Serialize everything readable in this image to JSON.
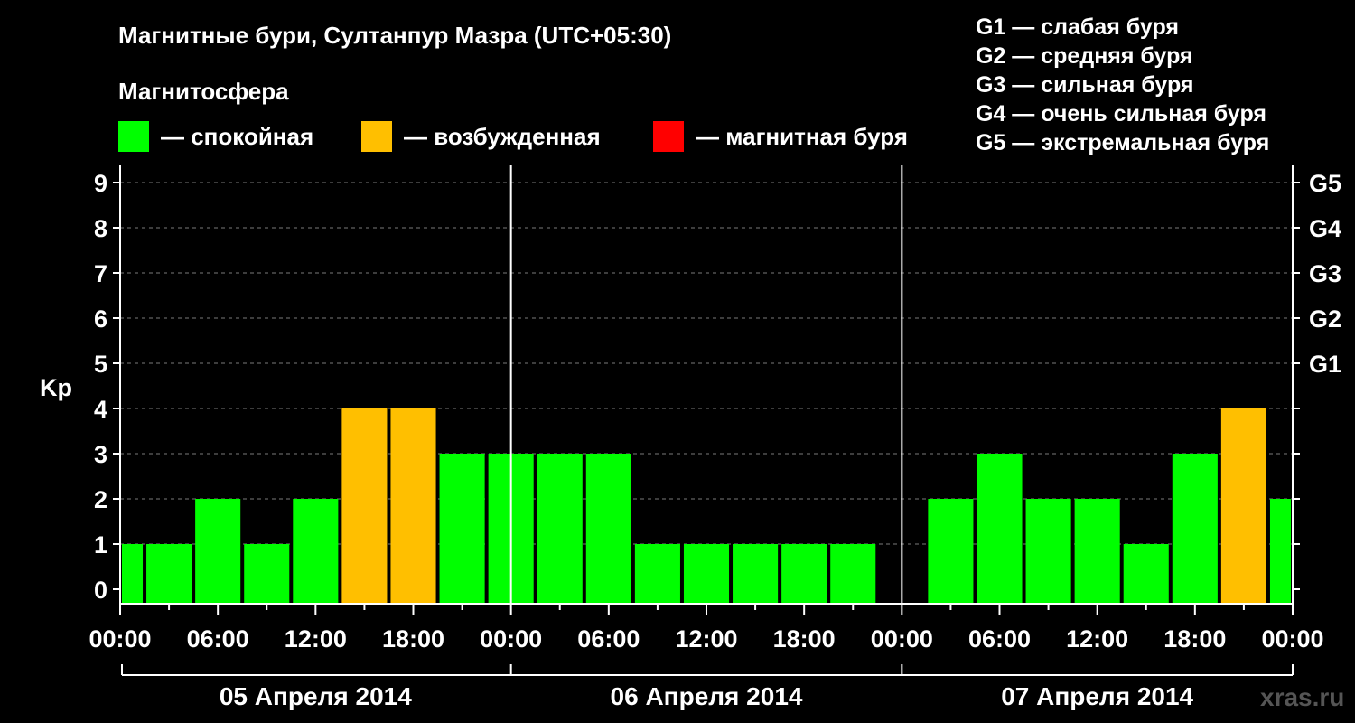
{
  "chart_data": {
    "type": "bar",
    "title": "Магнитные бури, Султанпур Мазра (UTC+05:30)",
    "subtitle": "Магнитосфера",
    "ylabel": "Kp",
    "ylim": [
      0,
      9
    ],
    "yticks": [
      "0",
      "1",
      "2",
      "3",
      "4",
      "5",
      "6",
      "7",
      "8",
      "9"
    ],
    "g_ticks": [
      {
        "kp": 5,
        "label": "G1"
      },
      {
        "kp": 6,
        "label": "G2"
      },
      {
        "kp": 7,
        "label": "G3"
      },
      {
        "kp": 8,
        "label": "G4"
      },
      {
        "kp": 9,
        "label": "G5"
      }
    ],
    "xticks": [
      "00:00",
      "06:00",
      "12:00",
      "18:00",
      "00:00",
      "06:00",
      "12:00",
      "18:00",
      "00:00",
      "06:00",
      "12:00",
      "18:00",
      "00:00"
    ],
    "days": [
      "05 Апреля 2014",
      "06 Апреля 2014",
      "07 Апреля 2014"
    ],
    "x_start_hours": 0,
    "x_span_hours": 72,
    "legend": [
      {
        "label": "— спокойная",
        "color": "#00FF00"
      },
      {
        "label": "— возбужденная",
        "color": "#FFBF00"
      },
      {
        "label": "— магнитная буря",
        "color": "#FF0000"
      }
    ],
    "g_legend": [
      "G1 — слабая буря",
      "G2 — средняя буря",
      "G3 — сильная буря",
      "G4 — очень сильная буря",
      "G5 — экстремальная буря"
    ],
    "series": [
      {
        "values": [
          {
            "start": 0,
            "end": 1.5,
            "kp": 1,
            "status": "calm"
          },
          {
            "start": 1.5,
            "end": 4.5,
            "kp": 1,
            "status": "calm"
          },
          {
            "start": 4.5,
            "end": 7.5,
            "kp": 2,
            "status": "calm"
          },
          {
            "start": 7.5,
            "end": 10.5,
            "kp": 1,
            "status": "calm"
          },
          {
            "start": 10.5,
            "end": 13.5,
            "kp": 2,
            "status": "calm"
          },
          {
            "start": 13.5,
            "end": 16.5,
            "kp": 4,
            "status": "active"
          },
          {
            "start": 16.5,
            "end": 19.5,
            "kp": 4,
            "status": "active"
          },
          {
            "start": 19.5,
            "end": 22.5,
            "kp": 3,
            "status": "calm"
          },
          {
            "start": 22.5,
            "end": 25.5,
            "kp": 3,
            "status": "calm"
          },
          {
            "start": 25.5,
            "end": 28.5,
            "kp": 3,
            "status": "calm"
          },
          {
            "start": 28.5,
            "end": 31.5,
            "kp": 3,
            "status": "calm"
          },
          {
            "start": 31.5,
            "end": 34.5,
            "kp": 1,
            "status": "calm"
          },
          {
            "start": 34.5,
            "end": 37.5,
            "kp": 1,
            "status": "calm"
          },
          {
            "start": 37.5,
            "end": 40.5,
            "kp": 1,
            "status": "calm"
          },
          {
            "start": 40.5,
            "end": 43.5,
            "kp": 1,
            "status": "calm"
          },
          {
            "start": 43.5,
            "end": 46.5,
            "kp": 1,
            "status": "calm"
          },
          {
            "start": 49.5,
            "end": 52.5,
            "kp": 2,
            "status": "calm"
          },
          {
            "start": 52.5,
            "end": 55.5,
            "kp": 3,
            "status": "calm"
          },
          {
            "start": 55.5,
            "end": 58.5,
            "kp": 2,
            "status": "calm"
          },
          {
            "start": 58.5,
            "end": 61.5,
            "kp": 2,
            "status": "calm"
          },
          {
            "start": 61.5,
            "end": 64.5,
            "kp": 1,
            "status": "calm"
          },
          {
            "start": 64.5,
            "end": 67.5,
            "kp": 3,
            "status": "calm"
          },
          {
            "start": 67.5,
            "end": 70.5,
            "kp": 4,
            "status": "active"
          },
          {
            "start": 70.5,
            "end": 72,
            "kp": 2,
            "status": "calm"
          }
        ]
      }
    ],
    "status_colors": {
      "calm": "#00FF00",
      "active": "#FFBF00",
      "storm": "#FF0000"
    },
    "grid": true
  },
  "watermark": "xras.ru"
}
